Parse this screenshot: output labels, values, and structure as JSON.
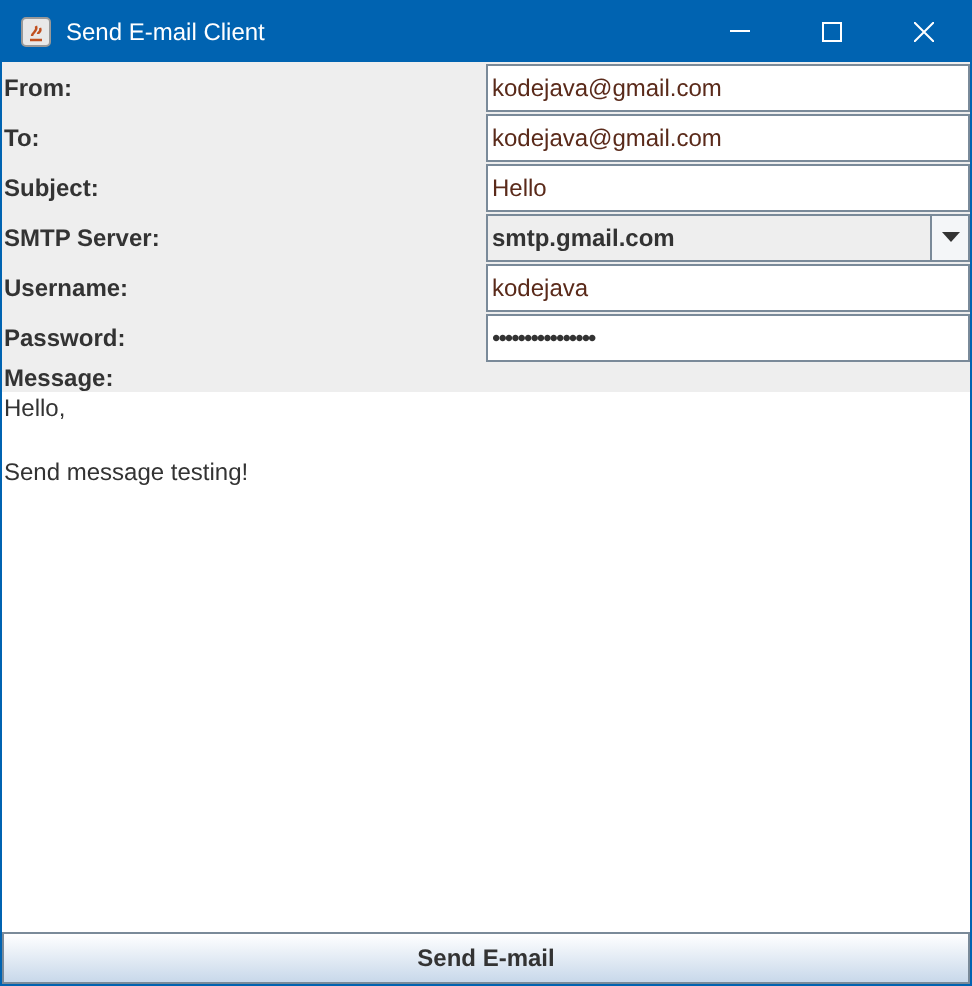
{
  "window": {
    "title": "Send E-mail Client"
  },
  "fields": [
    {
      "label": "From:",
      "kind": "text",
      "value": "kodejava@gmail.com"
    },
    {
      "label": "To:",
      "kind": "text",
      "value": "kodejava@gmail.com"
    },
    {
      "label": "Subject:",
      "kind": "text",
      "value": "Hello"
    },
    {
      "label": "SMTP Server:",
      "kind": "combo",
      "value": "smtp.gmail.com"
    },
    {
      "label": "Username:",
      "kind": "text",
      "value": "kodejava"
    },
    {
      "label": "Password:",
      "kind": "password",
      "value": "••••••••••••••••"
    }
  ],
  "message": {
    "label": "Message:",
    "value": "Hello,\n\nSend message testing!"
  },
  "send_button": "Send E-mail"
}
